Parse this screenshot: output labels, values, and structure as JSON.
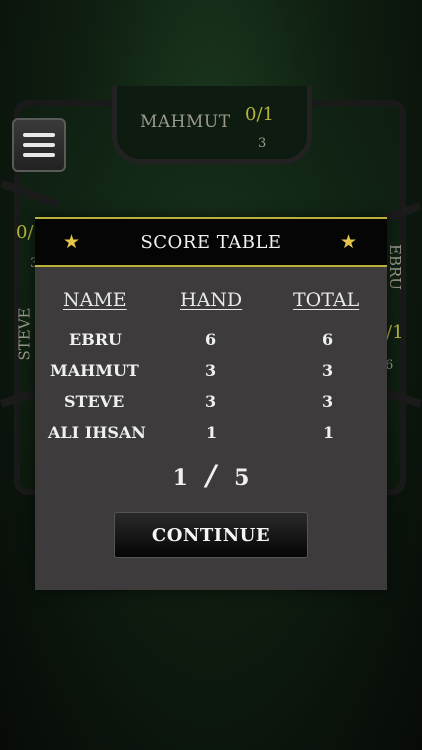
{
  "table": {
    "top_player": {
      "name": "MAHMUT",
      "score": "0/1",
      "sub": "3"
    },
    "left_player": {
      "name": "STEVE",
      "score": "0/",
      "sub": "3"
    },
    "right_player": {
      "name": "EBRU",
      "score": "/1",
      "sub": "6"
    }
  },
  "menu_icon": "hamburger-menu-icon",
  "dialog": {
    "title": "SCORE TABLE",
    "star_icon": "star-icon",
    "columns": [
      "NAME",
      "HAND",
      "TOTAL"
    ],
    "rows": [
      {
        "name": "EBRU",
        "hand": "6",
        "total": "6"
      },
      {
        "name": "MAHMUT",
        "hand": "3",
        "total": "3"
      },
      {
        "name": "STEVE",
        "hand": "3",
        "total": "3"
      },
      {
        "name": "ALI IHSAN",
        "hand": "1",
        "total": "1"
      }
    ],
    "page_current": "1",
    "page_separator": "/",
    "page_total": "5",
    "continue_label": "CONTINUE"
  },
  "colors": {
    "accent_gold": "#b9b13a",
    "star": "#e6c64a",
    "dialog_bg": "#3d3b3b",
    "header_bg": "#050505",
    "felt_green": "#16301a"
  }
}
